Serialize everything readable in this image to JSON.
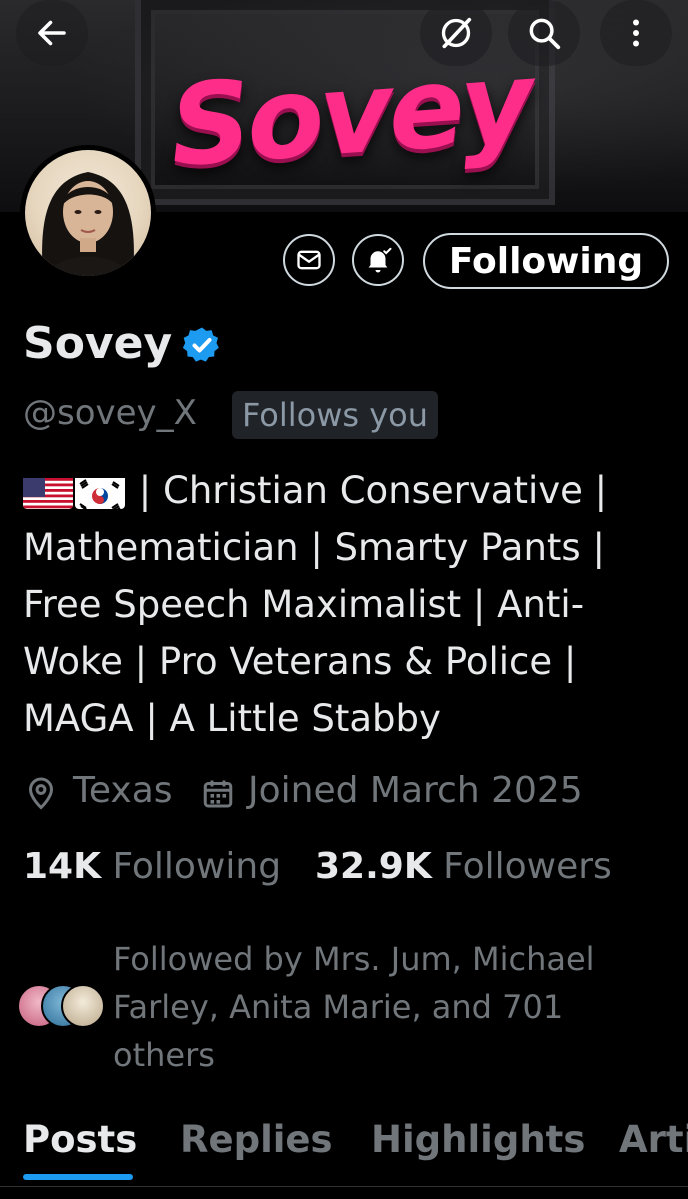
{
  "banner": {
    "logo_text": "Sovey"
  },
  "profile": {
    "name": "Sovey",
    "handle": "@sovey_X",
    "follows_you": "Follows you",
    "verified": true,
    "bio_text": "| Christian Conservative | Mathematician | Smarty Pants | Free Speech Maximalist | Anti-Woke | Pro Veterans & Police | MAGA | A Little Stabby",
    "bio_flags": [
      "us-flag",
      "kr-flag"
    ],
    "location": "Texas",
    "joined": "Joined March 2025"
  },
  "stats": {
    "following_count": "14K",
    "following_label": "Following",
    "followers_count": "32.9K",
    "followers_label": "Followers"
  },
  "followed_by": "Followed by Mrs. Jum, Michael Farley, Anita Marie, and 701 others",
  "actions": {
    "follow_state": "Following"
  },
  "tabs": [
    {
      "label": "Posts",
      "active": true
    },
    {
      "label": "Replies",
      "active": false
    },
    {
      "label": "Highlights",
      "active": false
    },
    {
      "label": "Arti",
      "active": false
    }
  ],
  "colors": {
    "accent": "#1d9bf0",
    "background": "#000000",
    "text": "#e7e9ea",
    "muted": "#71767b",
    "logo_pink": "#ff2d8a"
  },
  "icons": [
    "back-arrow-icon",
    "grok-icon",
    "search-icon",
    "more-vertical-icon",
    "mail-icon",
    "bell-check-icon",
    "location-icon",
    "calendar-icon",
    "verified-badge-icon"
  ]
}
